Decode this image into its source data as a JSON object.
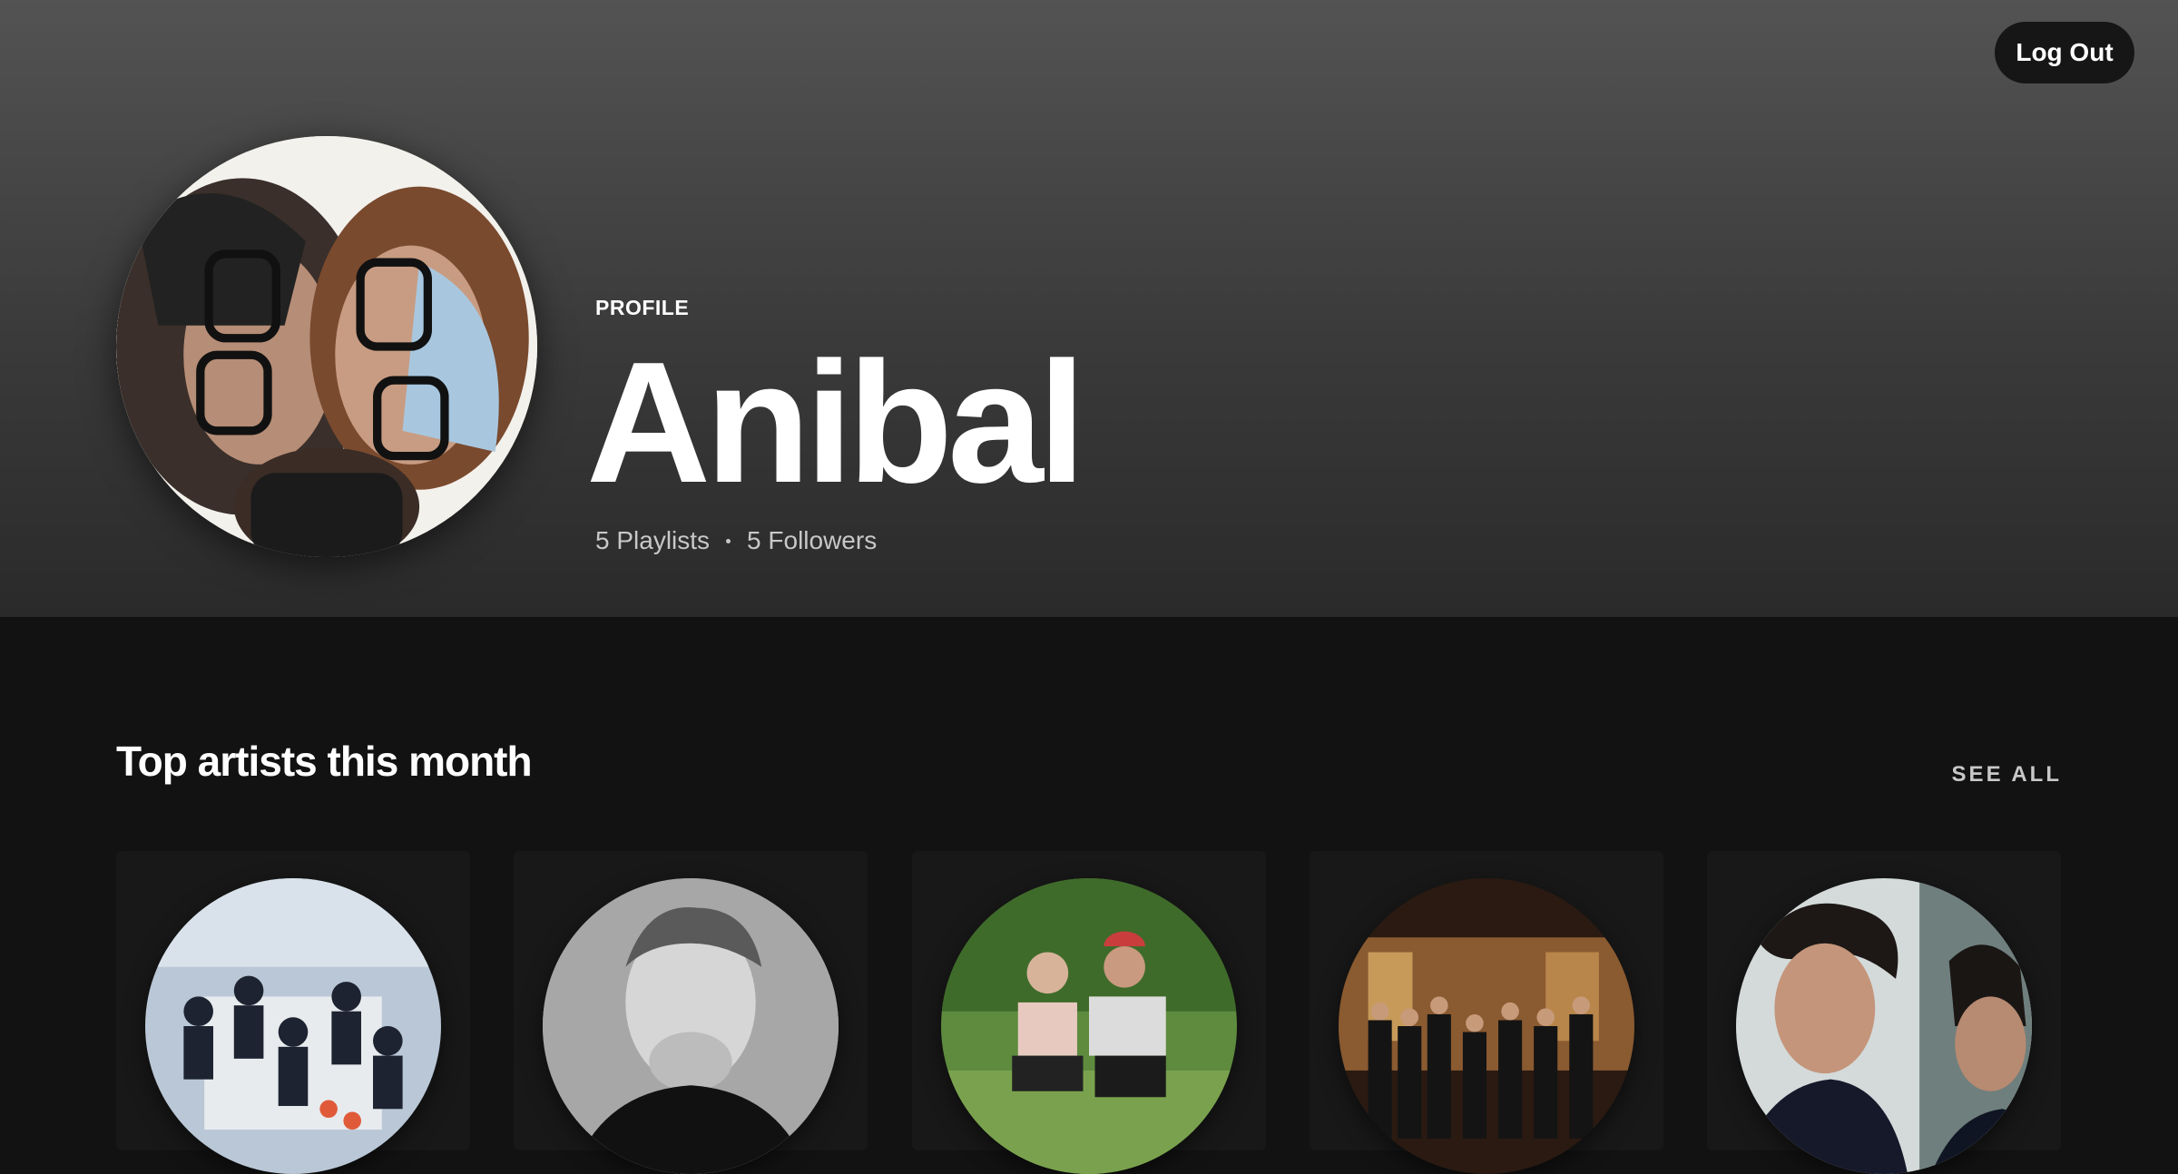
{
  "header": {
    "logout_label": "Log Out"
  },
  "profile": {
    "label": "PROFILE",
    "name": "Anibal",
    "playlists": "5 Playlists",
    "followers": "5 Followers"
  },
  "top_artists": {
    "title": "Top artists this month",
    "see_all_label": "SEE ALL"
  },
  "colors": {
    "background": "#121212",
    "card": "#181818",
    "hero_top": "#535353",
    "text_muted": "#c8c8c8"
  }
}
